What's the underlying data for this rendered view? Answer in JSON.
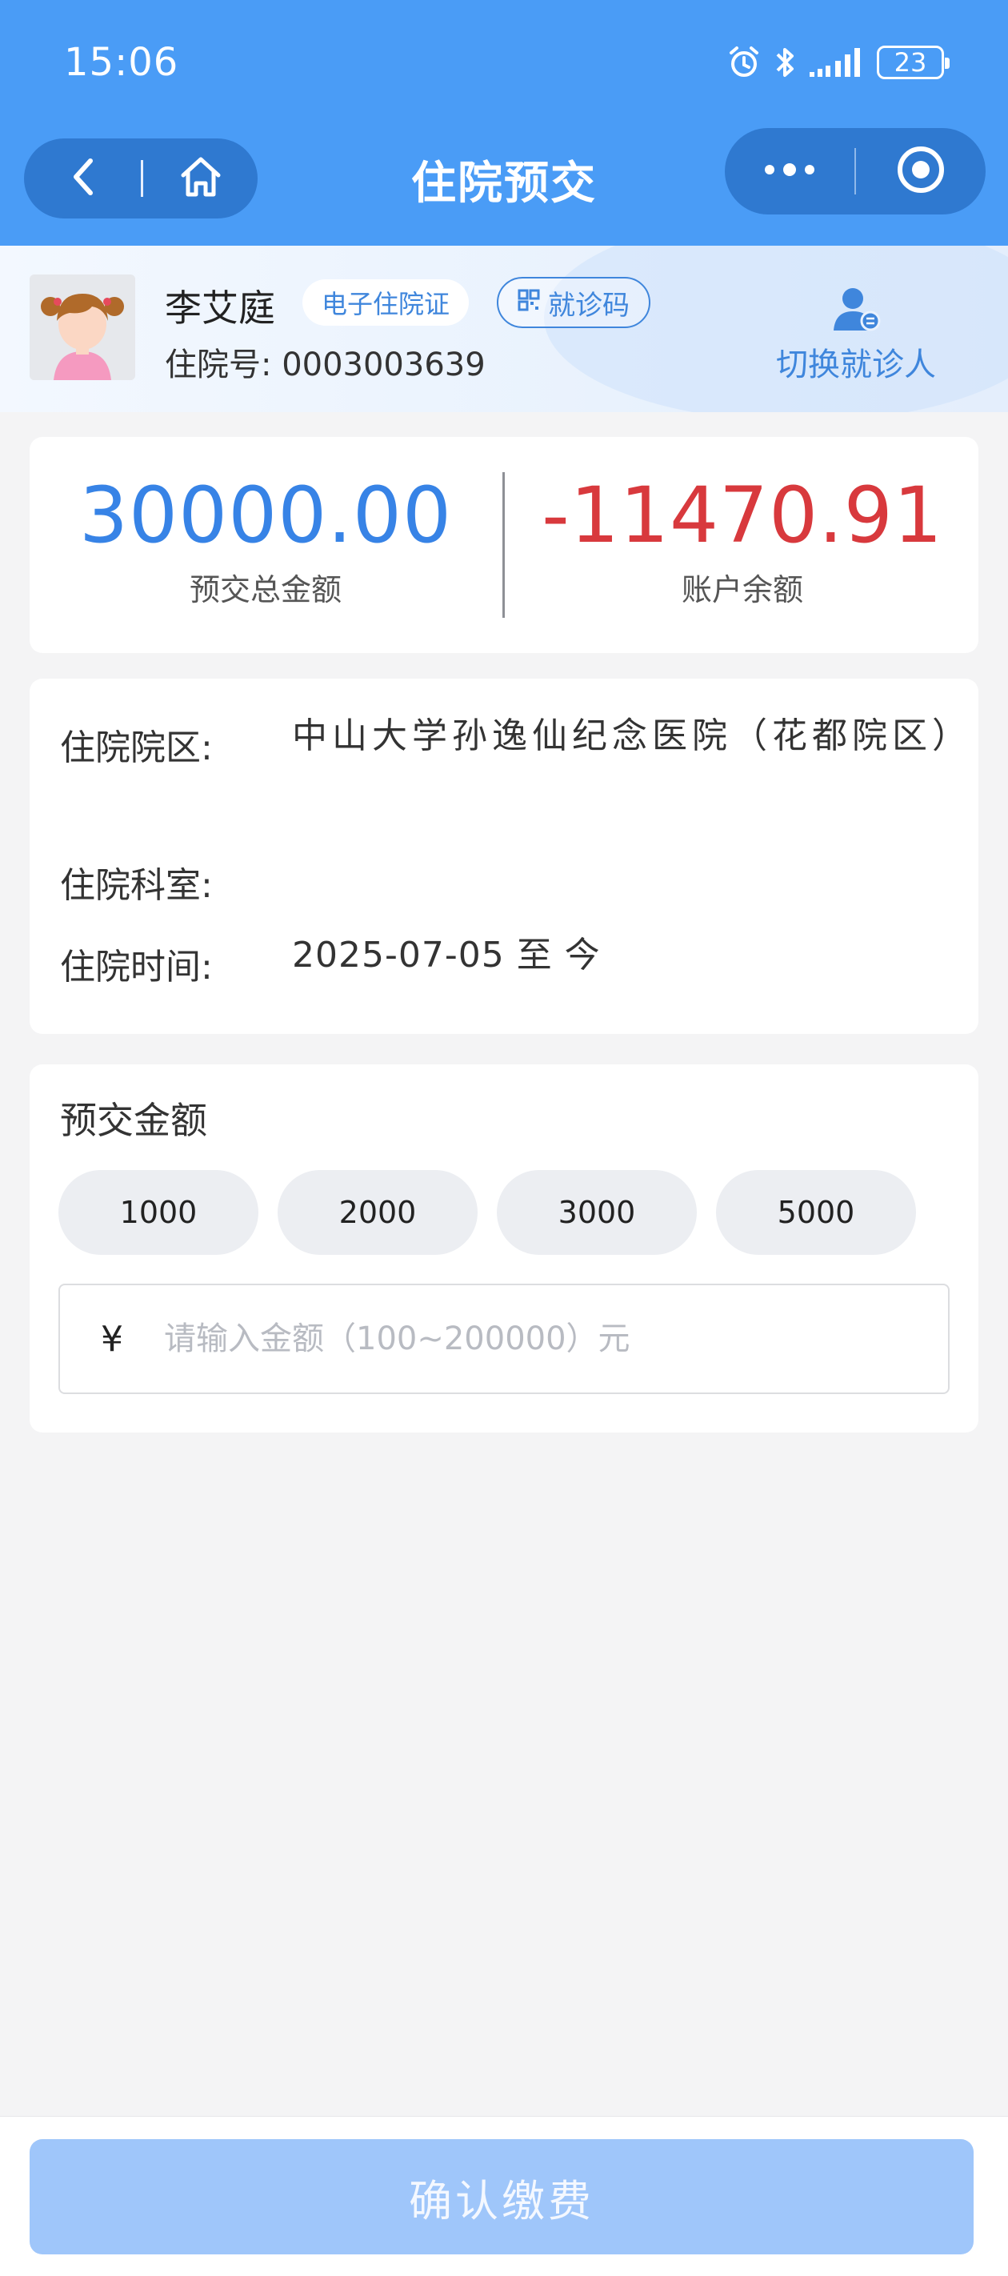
{
  "status_bar": {
    "time": "15:06",
    "battery": "23",
    "icons": [
      "alarm-icon",
      "bluetooth-icon",
      "signal-icon",
      "battery-icon"
    ]
  },
  "nav": {
    "title": "住院预交",
    "left_icons": [
      "back-icon",
      "home-icon"
    ],
    "right_icons": [
      "more-icon",
      "close-miniprogram-icon"
    ]
  },
  "patient": {
    "name": "李艾庭",
    "ecard_label": "电子住院证",
    "qr_label": "就诊码",
    "inpatient_no": "住院号: 0003003639",
    "switch_label": "切换就诊人"
  },
  "summary": {
    "total_prepaid": "30000.00",
    "total_prepaid_label": "预交总金额",
    "balance": "-11470.91",
    "balance_label": "账户余额",
    "colors": {
      "prepaid": "#3783e6",
      "balance": "#d8393d"
    }
  },
  "admission": {
    "campus_label": "住院院区:",
    "campus_value": "中山大学孙逸仙纪念医院（花都院区）",
    "department_label": "住院科室:",
    "department_value": "",
    "time_label": "住院时间:",
    "time_value": "2025-07-05 至 今"
  },
  "prepay": {
    "title": "预交金额",
    "options": [
      "1000",
      "2000",
      "3000",
      "5000"
    ],
    "currency": "¥",
    "input_value": "",
    "input_placeholder": "请输入金额（100~200000）元"
  },
  "footer": {
    "confirm_label": "确认缴费"
  },
  "theme": {
    "primary": "#4a9cf6",
    "button_disabled": "#9fc6fa"
  }
}
